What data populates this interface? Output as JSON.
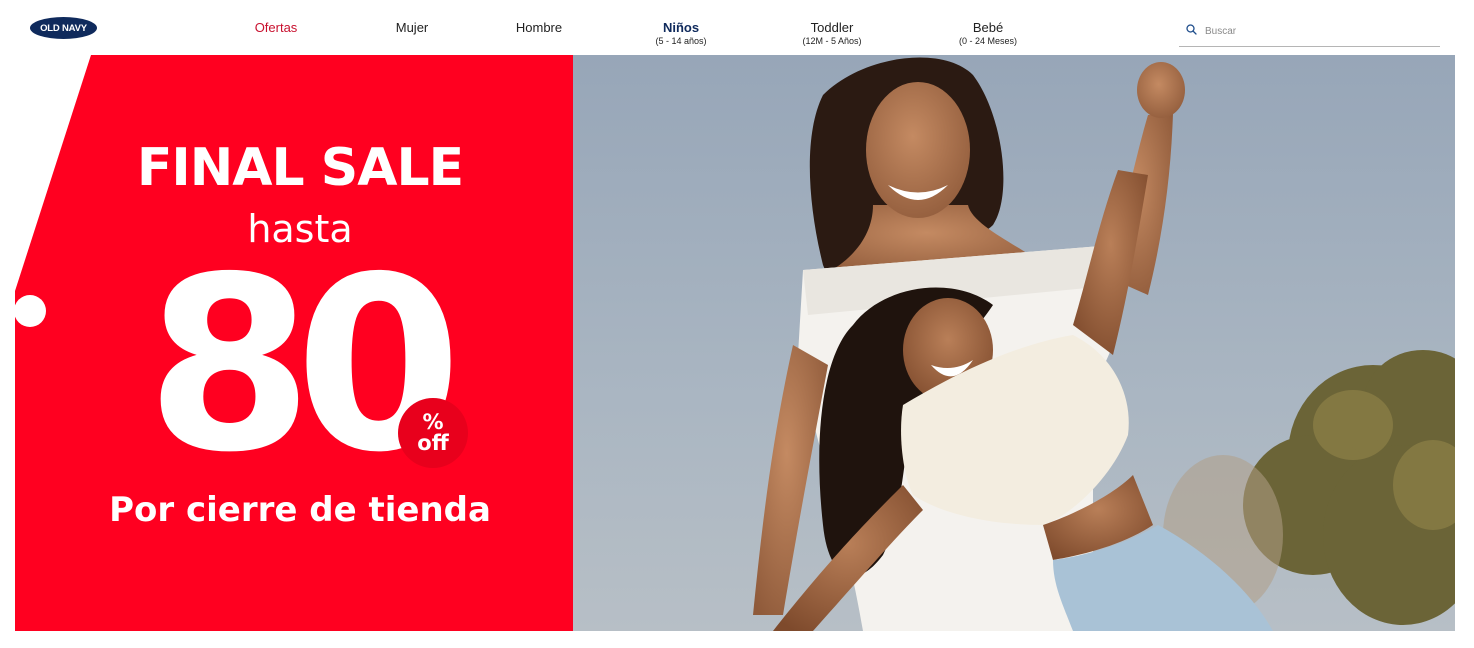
{
  "brand": {
    "logo_text": "OLD NAVY",
    "color": "#0f2a5c"
  },
  "nav": {
    "items": [
      {
        "label": "Ofertas",
        "sub": ""
      },
      {
        "label": "Mujer",
        "sub": ""
      },
      {
        "label": "Hombre",
        "sub": ""
      },
      {
        "label": "Niños",
        "sub": "(5 - 14 años)"
      },
      {
        "label": "Toddler",
        "sub": "(12M - 5 Años)"
      },
      {
        "label": "Bebé",
        "sub": "(0 - 24 Meses)"
      }
    ],
    "deals_color": "#c8102e"
  },
  "search": {
    "placeholder": "Buscar",
    "value": "",
    "icon": "search-icon"
  },
  "hero": {
    "headline": "FINAL SALE",
    "prefix": "hasta",
    "discount_number": "80",
    "percent_symbol": "%",
    "off_text": "off",
    "subline": "Por cierre de tienda",
    "promo_color": "#ff0020"
  }
}
